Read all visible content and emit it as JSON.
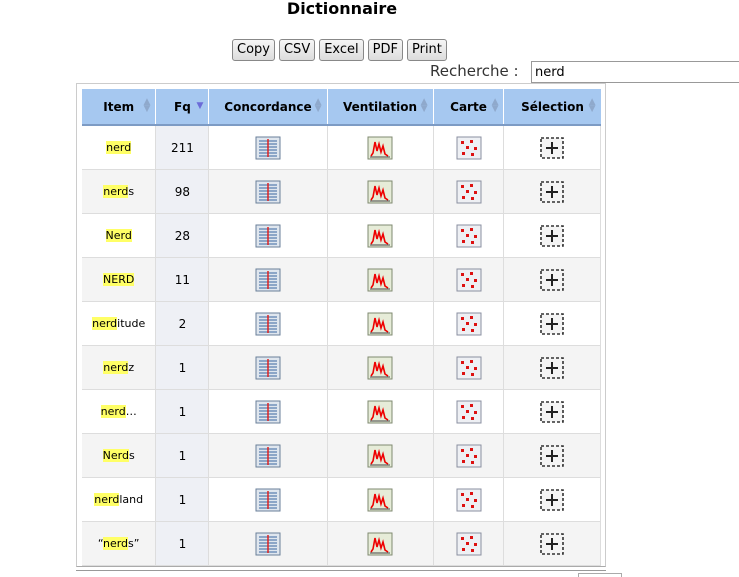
{
  "page_title": "Dictionnaire",
  "toolbar": {
    "copy": "Copy",
    "csv": "CSV",
    "excel": "Excel",
    "pdf": "PDF",
    "print": "Print"
  },
  "search": {
    "label": "Recherche :",
    "value": "nerd"
  },
  "table": {
    "headers": [
      "Item",
      "Fq",
      "Concordance",
      "Ventilation",
      "Carte",
      "Sélection"
    ],
    "sorted_column": "Fq",
    "rows": [
      {
        "pre": "",
        "hl": "nerd",
        "post": "",
        "fq": "211"
      },
      {
        "pre": "",
        "hl": "nerd",
        "post": "s",
        "fq": "98"
      },
      {
        "pre": "",
        "hl": "Nerd",
        "post": "",
        "fq": "28"
      },
      {
        "pre": "",
        "hl": "NERD",
        "post": "",
        "fq": "11"
      },
      {
        "pre": "",
        "hl": "nerd",
        "post": "itude",
        "fq": "2"
      },
      {
        "pre": "",
        "hl": "nerd",
        "post": "z",
        "fq": "1"
      },
      {
        "pre": "",
        "hl": "nerd",
        "post": "…",
        "fq": "1"
      },
      {
        "pre": "",
        "hl": "Nerd",
        "post": "s",
        "fq": "1"
      },
      {
        "pre": "",
        "hl": "nerd",
        "post": "land",
        "fq": "1"
      },
      {
        "pre": "“",
        "hl": "nerd",
        "post": "s”",
        "fq": "1"
      }
    ]
  },
  "icons": {
    "concordance": "concordance-icon",
    "ventilation": "ventilation-chart-icon",
    "carte": "map-icon",
    "selection": "add-selection-icon"
  }
}
